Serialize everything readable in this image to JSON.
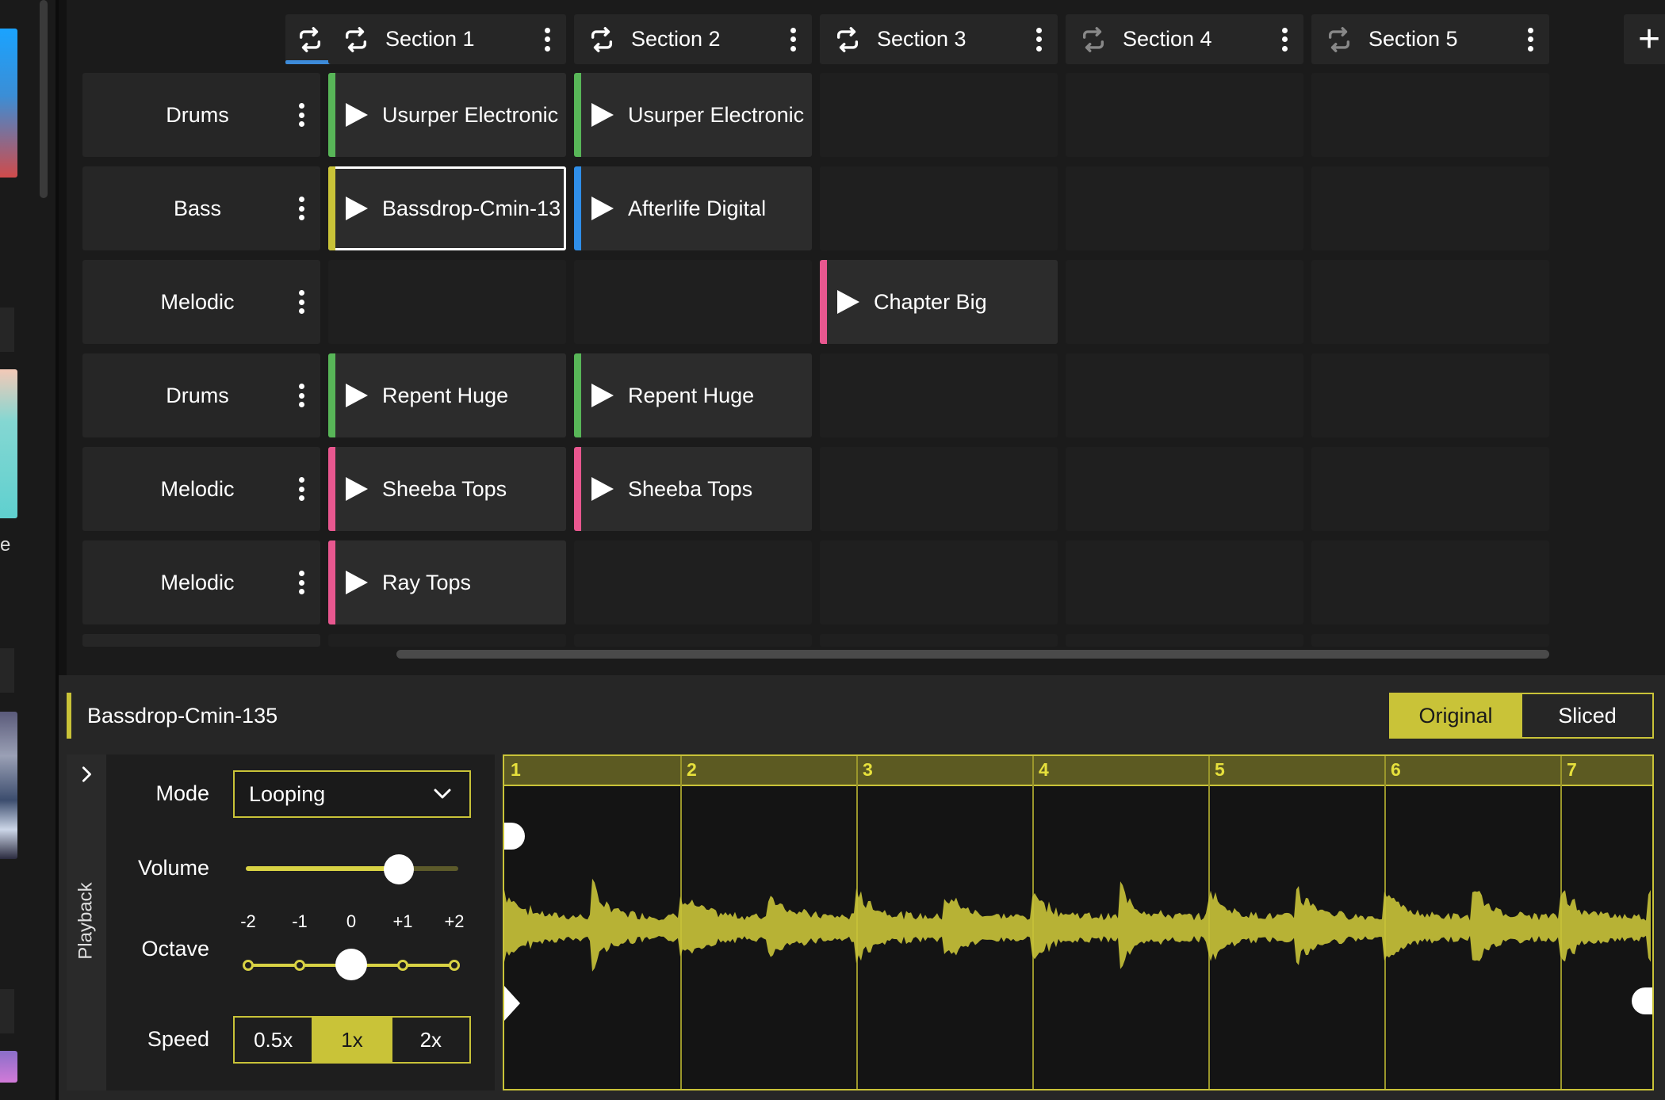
{
  "left": {
    "partial_text": "e"
  },
  "session": {
    "section_header_icons": [
      "loop-icon",
      "play-all-icon"
    ],
    "sections": [
      {
        "label": "Section 1",
        "loop_active": true
      },
      {
        "label": "Section 2",
        "loop_active": true
      },
      {
        "label": "Section 3",
        "loop_active": true
      },
      {
        "label": "Section 4",
        "loop_active": false
      },
      {
        "label": "Section 5",
        "loop_active": false
      }
    ],
    "add_section_label": "+",
    "tracks": [
      {
        "name": "Drums",
        "clips": [
          {
            "section": 0,
            "name": "Usurper Electronic",
            "color": "#58b658"
          },
          {
            "section": 1,
            "name": "Usurper Electronic",
            "color": "#58b658"
          }
        ]
      },
      {
        "name": "Bass",
        "clips": [
          {
            "section": 0,
            "name": "Bassdrop-Cmin-13",
            "color": "#c9c338",
            "selected": true
          },
          {
            "section": 1,
            "name": "Afterlife Digital",
            "color": "#2f8ee8"
          }
        ]
      },
      {
        "name": "Melodic",
        "clips": [
          {
            "section": 2,
            "name": "Chapter Big",
            "color": "#e8578f"
          }
        ]
      },
      {
        "name": "Drums",
        "clips": [
          {
            "section": 0,
            "name": "Repent Huge",
            "color": "#58b658"
          },
          {
            "section": 1,
            "name": "Repent Huge",
            "color": "#58b658"
          }
        ]
      },
      {
        "name": "Melodic",
        "clips": [
          {
            "section": 0,
            "name": "Sheeba Tops",
            "color": "#e8578f"
          },
          {
            "section": 1,
            "name": "Sheeba Tops",
            "color": "#e8578f"
          }
        ]
      },
      {
        "name": "Melodic",
        "clips": [
          {
            "section": 0,
            "name": "Ray Tops",
            "color": "#e8578f"
          }
        ]
      }
    ]
  },
  "editor": {
    "clip_name": "Bassdrop-Cmin-135",
    "clip_color": "#c9c338",
    "view_options": [
      "Original",
      "Sliced"
    ],
    "view_selected": "Original",
    "playback": {
      "panel_label": "Playback",
      "mode_label": "Mode",
      "mode_value": "Looping",
      "volume_label": "Volume",
      "volume_level": 0.72,
      "octave_label": "Octave",
      "octave_ticks": [
        "-2",
        "-1",
        "0",
        "+1",
        "+2"
      ],
      "octave_value": "0",
      "speed_label": "Speed",
      "speed_options": [
        "0.5x",
        "1x",
        "2x"
      ],
      "speed_selected": "1x"
    },
    "waveform": {
      "beats": [
        "1",
        "2",
        "3",
        "4",
        "5",
        "6",
        "7"
      ]
    }
  },
  "colors": {
    "accent": "#c9c338",
    "background": "#121212",
    "panel": "#262626",
    "tab_underline": "#3d8bd9"
  }
}
